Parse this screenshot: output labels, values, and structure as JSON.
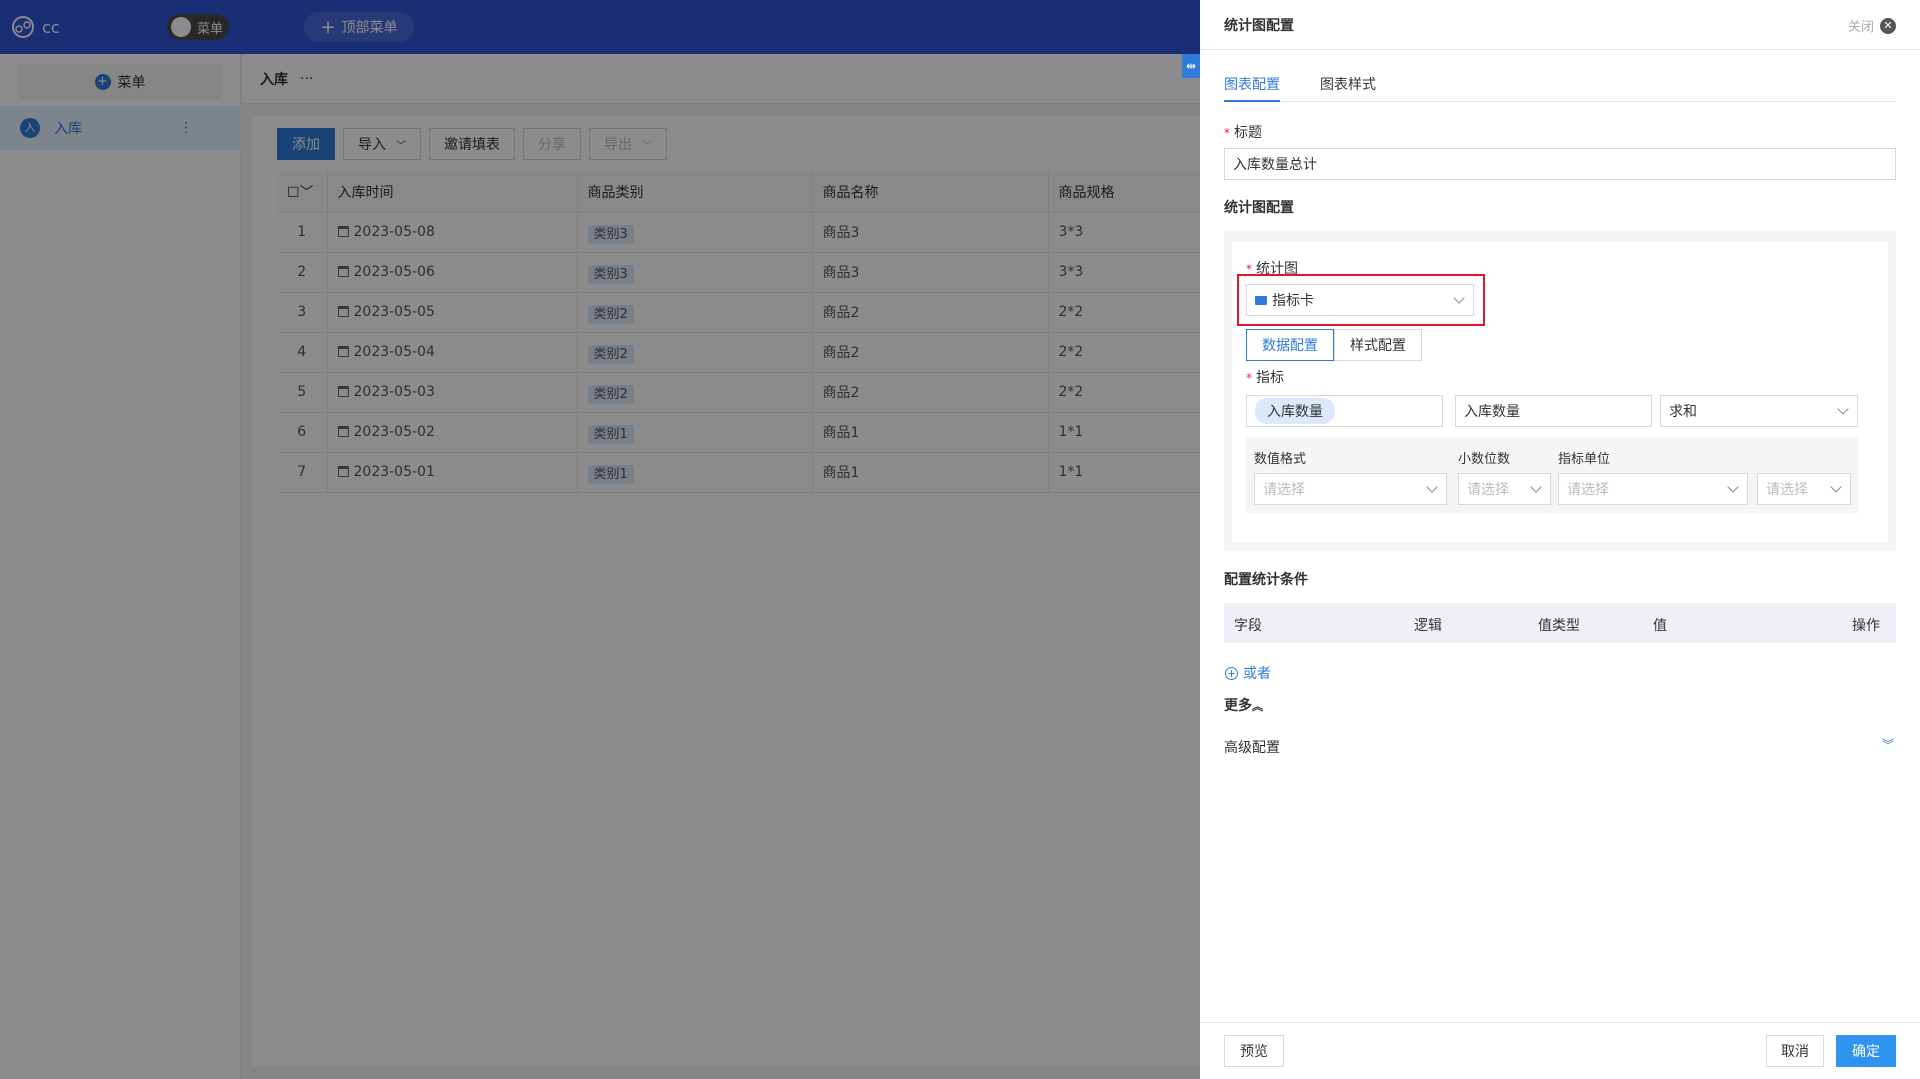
{
  "app": {
    "logo_text": "cc",
    "menu_toggle_label": "菜单",
    "top_menu_label": "顶部菜单"
  },
  "sidebar": {
    "add_menu_label": "菜单",
    "items": [
      {
        "avatar": "入",
        "label": "入库",
        "icon": "more-vertical-icon"
      }
    ]
  },
  "page": {
    "title": "入库",
    "more": "···"
  },
  "toolbar": {
    "add": "添加",
    "import": "导入",
    "invite": "邀请填表",
    "share": "分享",
    "export": "导出"
  },
  "table": {
    "columns": [
      "入库时间",
      "商品类别",
      "商品名称",
      "商品规格"
    ],
    "rows": [
      {
        "idx": "1",
        "date": "2023-05-08",
        "category": "类别3",
        "name": "商品3",
        "spec": "3*3"
      },
      {
        "idx": "2",
        "date": "2023-05-06",
        "category": "类别3",
        "name": "商品3",
        "spec": "3*3"
      },
      {
        "idx": "3",
        "date": "2023-05-05",
        "category": "类别2",
        "name": "商品2",
        "spec": "2*2"
      },
      {
        "idx": "4",
        "date": "2023-05-04",
        "category": "类别2",
        "name": "商品2",
        "spec": "2*2"
      },
      {
        "idx": "5",
        "date": "2023-05-03",
        "category": "类别2",
        "name": "商品2",
        "spec": "2*2"
      },
      {
        "idx": "6",
        "date": "2023-05-02",
        "category": "类别1",
        "name": "商品1",
        "spec": "1*1"
      },
      {
        "idx": "7",
        "date": "2023-05-01",
        "category": "类别1",
        "name": "商品1",
        "spec": "1*1"
      }
    ]
  },
  "drawer": {
    "title": "统计图配置",
    "close_label": "关闭",
    "tabs": [
      "图表配置",
      "图表样式"
    ],
    "title_field": {
      "label": "标题",
      "value": "入库数量总计"
    },
    "stats_section": "统计图配置",
    "chart_type": {
      "label": "统计图",
      "value": "指标卡"
    },
    "seg": [
      "数据配置",
      "样式配置"
    ],
    "metric": {
      "label": "指标",
      "field_chip": "入库数量",
      "alias": "入库数量",
      "agg": "求和"
    },
    "format": {
      "number_format_label": "数值格式",
      "decimals_label": "小数位数",
      "unit_label": "指标单位",
      "placeholder": "请选择"
    },
    "conditions": {
      "title": "配置统计条件",
      "columns": [
        "字段",
        "逻辑",
        "值类型",
        "值",
        "操作"
      ],
      "or_label": "或者"
    },
    "more_label": "更多",
    "advanced_label": "高级配置",
    "footer": {
      "preview": "预览",
      "cancel": "取消",
      "ok": "确定"
    }
  },
  "colors": {
    "accent": "#2f7bd8",
    "topbar": "#2f55d4",
    "highlight": "#e0162b"
  }
}
